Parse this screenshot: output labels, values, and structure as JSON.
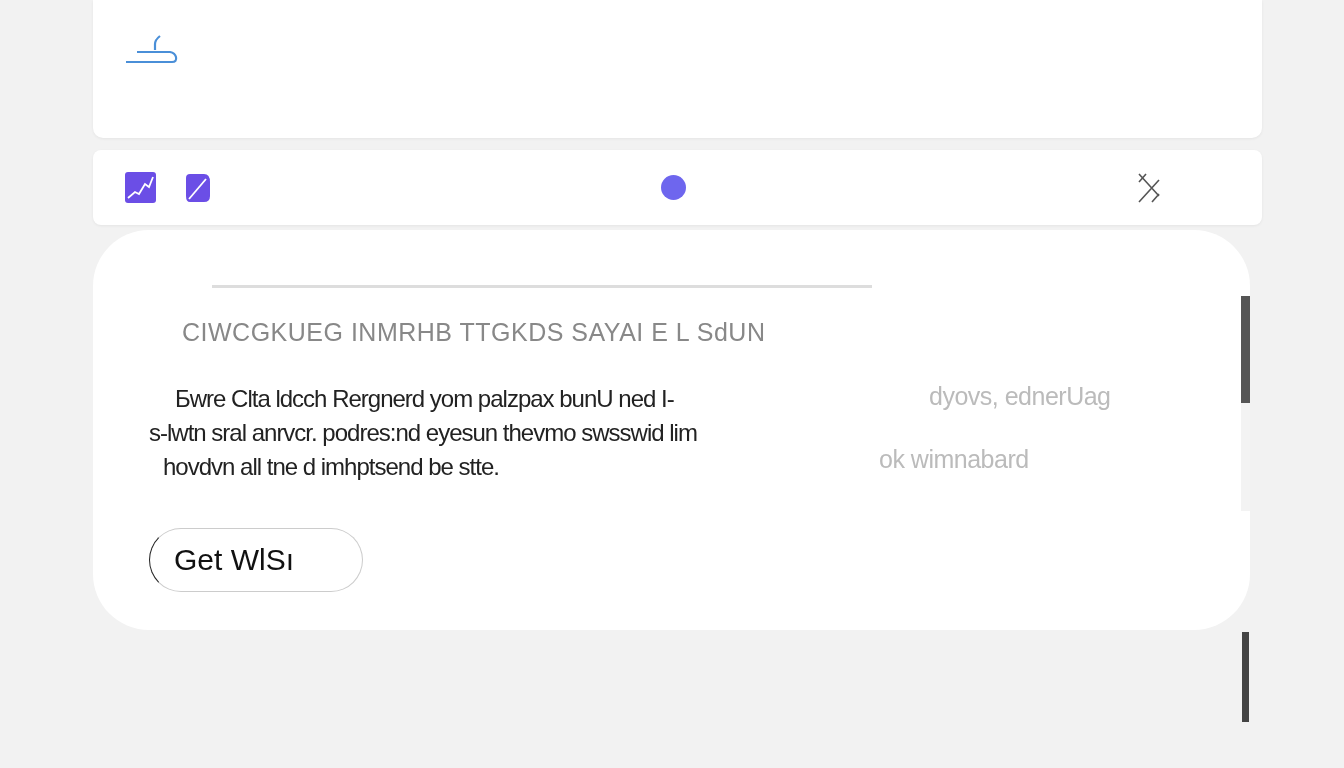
{
  "card": {
    "heading": "CIWCGKUEG INMRHB TTGKDS SAYAI E L SdUN",
    "paragraph": [
      "Бwre Clta ldcch Rergnerd yom palzpax bunU ned I-",
      "s-lwtn sral anrvcr. podres:nd eyesun thevmo swsswid lim",
      "hovdvn all tne d imhptsend be stte."
    ],
    "side_texts": [
      "dyovs, ednerUag",
      "ok wimnabard"
    ],
    "button": "Get WlSı"
  }
}
